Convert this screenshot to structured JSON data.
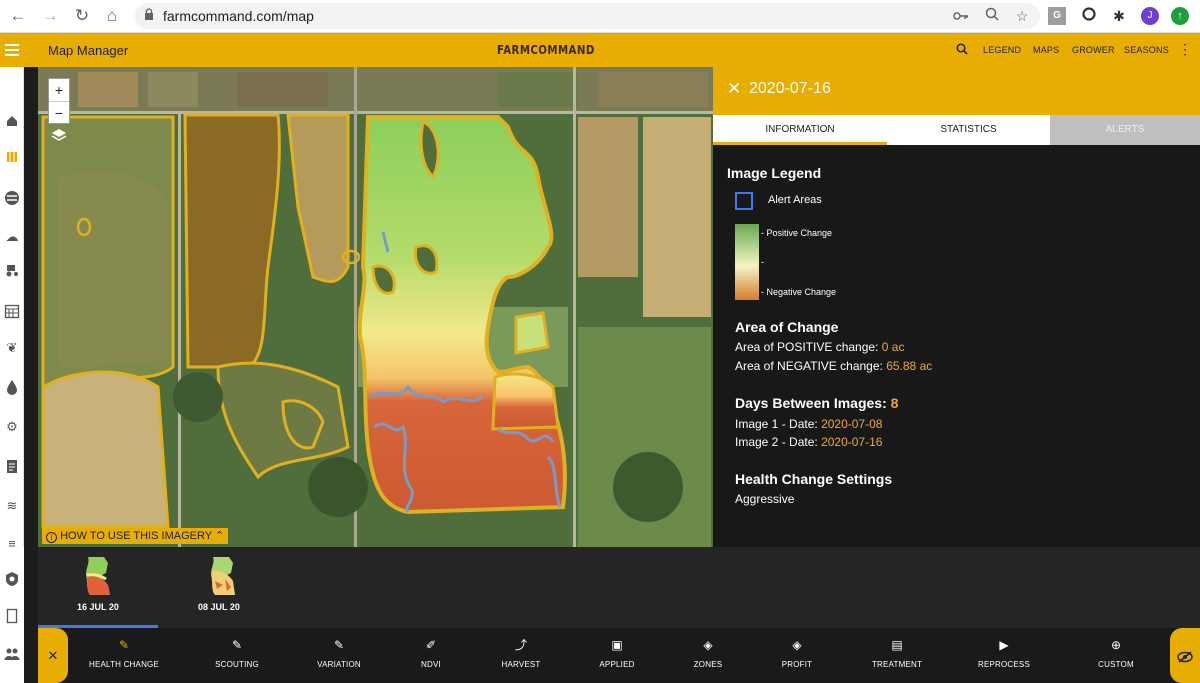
{
  "browser": {
    "url": "farmcommand.com/map",
    "back_icon": "←",
    "forward_icon": "→",
    "reload_icon": "↻",
    "home_icon": "⌂",
    "lock_icon": "🔒",
    "profile_initial": "J"
  },
  "header": {
    "title": "Map Manager",
    "logo": "FARMCOMMAND",
    "nav": [
      "LEGEND",
      "MAPS",
      "GROWER",
      "SEASONS"
    ]
  },
  "map": {
    "zoom_in": "+",
    "zoom_out": "−",
    "howto": "HOW TO USE THIS IMAGERY"
  },
  "panel": {
    "date": "2020-07-16",
    "tabs": [
      "INFORMATION",
      "STATISTICS",
      "ALERTS"
    ],
    "legend_title": "Image Legend",
    "alert_areas": "Alert Areas",
    "positive_change": "- Positive Change",
    "mid_tick": "-",
    "negative_change": "- Negative Change",
    "area_title": "Area of Change",
    "positive_label": "Area of POSITIVE change:",
    "positive_value": "0 ac",
    "negative_label": "Area of NEGATIVE change:",
    "negative_value": "65.88 ac",
    "days_label": "Days Between Images:",
    "days_value": "8",
    "image1_label": "Image 1 - Date:",
    "image1_value": "2020-07-08",
    "image2_label": "Image 2 - Date:",
    "image2_value": "2020-07-16",
    "settings_title": "Health Change Settings",
    "settings_value": "Aggressive"
  },
  "thumbnails": [
    {
      "label": "16 JUL 20"
    },
    {
      "label": "08 JUL 20"
    }
  ],
  "toolbar": {
    "close": "✕",
    "tools": [
      {
        "label": "HEALTH CHANGE",
        "icon": "health-change-icon"
      },
      {
        "label": "SCOUTING",
        "icon": "scouting-icon"
      },
      {
        "label": "VARIATION",
        "icon": "variation-icon"
      },
      {
        "label": "NDVI",
        "icon": "ndvi-icon"
      },
      {
        "label": "HARVEST",
        "icon": "harvest-icon"
      },
      {
        "label": "APPLIED",
        "icon": "applied-icon"
      },
      {
        "label": "ZONES",
        "icon": "zones-icon"
      },
      {
        "label": "PROFIT",
        "icon": "profit-icon"
      },
      {
        "label": "TREATMENT",
        "icon": "treatment-icon"
      },
      {
        "label": "REPROCESS",
        "icon": "reprocess-icon"
      },
      {
        "label": "CUSTOM",
        "icon": "custom-icon"
      }
    ]
  },
  "colors": {
    "accent": "#e8ad02",
    "positive": "#6aa84f",
    "negative": "#d87c2c",
    "alert_outline": "#3f7be8",
    "value_text": "#f0a928"
  }
}
